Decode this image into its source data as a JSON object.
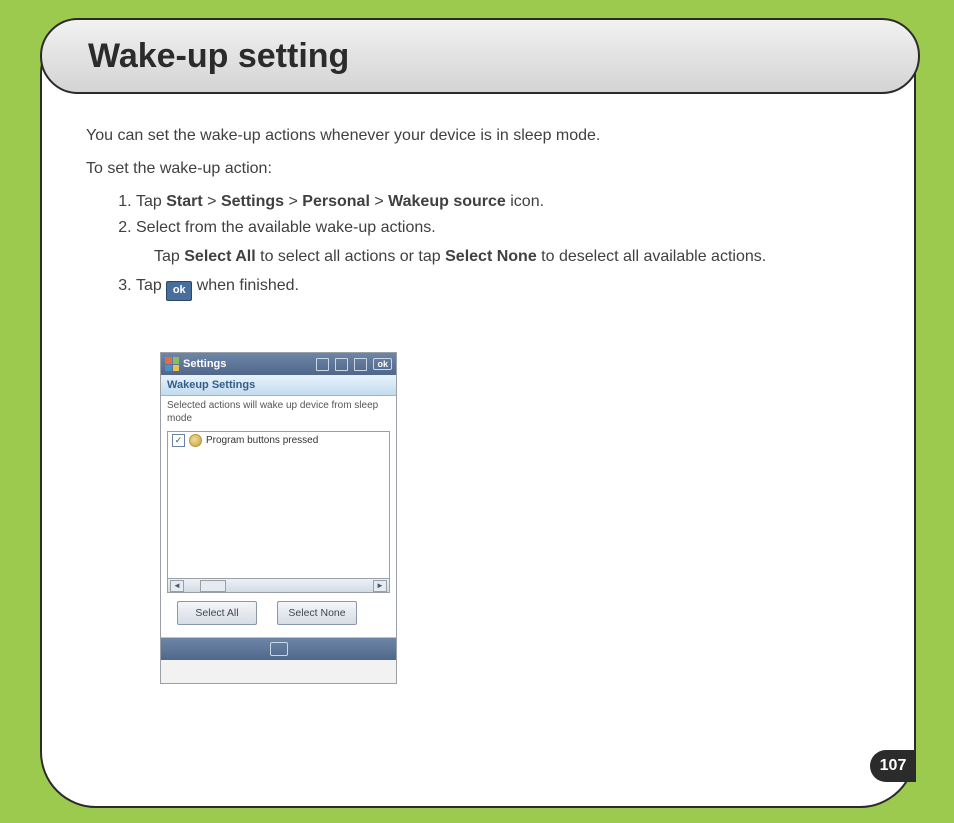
{
  "page": {
    "title": "Wake-up setting",
    "intro1": "You can set the wake-up actions whenever your device is in sleep mode.",
    "intro2": "To set the wake-up action:",
    "number": "107"
  },
  "steps": {
    "s1a": "Tap ",
    "s1_start": "Start",
    "s1_gt1": " > ",
    "s1_settings": "Settings",
    "s1_gt2": " > ",
    "s1_personal": "Personal",
    "s1_gt3": " > ",
    "s1_wakeup": "Wakeup source",
    "s1b": " icon.",
    "s2": "Select from the available wake-up actions.",
    "s2sub_a": "Tap ",
    "s2sub_selall": "Select All",
    "s2sub_b": " to select all actions or tap ",
    "s2sub_selnone": "Select None",
    "s2sub_c": " to deselect all available actions.",
    "s3a": "Tap ",
    "s3_ok": "ok",
    "s3b": " when finished."
  },
  "screenshot": {
    "topTitle": "Settings",
    "okLabel": "ok",
    "subTitle": "Wakeup Settings",
    "desc": "Selected actions will wake up device from sleep mode",
    "item1": "Program buttons pressed",
    "btnAll": "Select All",
    "btnNone": "Select None"
  }
}
